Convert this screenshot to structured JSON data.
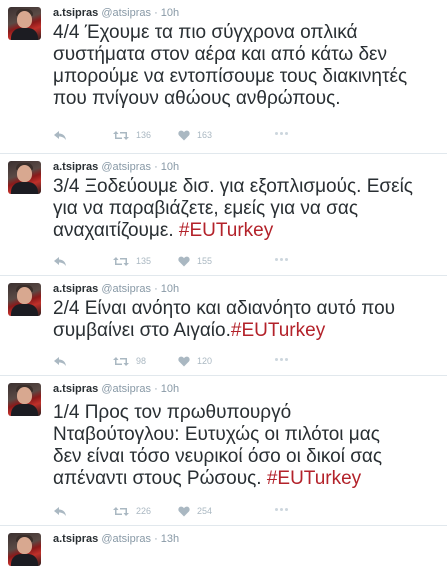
{
  "tweets": [
    {
      "name": "a.tsipras",
      "handle": "@atsipras",
      "sep": "·",
      "time": "10h",
      "lines": [
        "4/4 Έχουμε τα πιο σύγχρονα οπλικά",
        "συστήματα στον αέρα και από κάτω δεν",
        "μπορούμε να εντοπίσουμε τους διακινητές",
        "που πνίγουν αθώους ανθρώπους."
      ],
      "hashtag": "",
      "retweets": "136",
      "likes": "163"
    },
    {
      "name": "a.tsipras",
      "handle": "@atsipras",
      "sep": "·",
      "time": "10h",
      "lines": [
        "3/4 Ξοδεύουμε δισ. για εξοπλισμούς. Εσείς",
        "για να παραβιάζετε, εμείς για να σας",
        "αναχαιτίζουμε. "
      ],
      "hashtag": "#EUTurkey",
      "retweets": "135",
      "likes": "155"
    },
    {
      "name": "a.tsipras",
      "handle": "@atsipras",
      "sep": "·",
      "time": "10h",
      "lines": [
        "2/4 Είναι ανόητο και αδιανόητο αυτό που",
        "συμβαίνει στο Αιγαίο."
      ],
      "hashtag": "#EUTurkey",
      "retweets": "98",
      "likes": "120"
    },
    {
      "name": "a.tsipras",
      "handle": "@atsipras",
      "sep": "·",
      "time": "10h",
      "lines": [
        "1/4 Προς τον πρωθυπουργό",
        "Νταβούτογλου: Ευτυχώς οι πιλότοι μας",
        "δεν είναι τόσο νευρικοί όσο οι δικοί σας",
        "απέναντι στους Ρώσους. "
      ],
      "hashtag": "#EUTurkey",
      "retweets": "226",
      "likes": "254"
    },
    {
      "name": "a.tsipras",
      "handle": "@atsipras",
      "sep": "·",
      "time": "13h",
      "lines": [],
      "hashtag": "",
      "retweets": "",
      "likes": ""
    }
  ],
  "colors": {
    "hashtag": "#b3222a",
    "meta": "#8899a6",
    "icon": "#aab8c2",
    "divider": "#e1e8ed"
  },
  "icons": {
    "reply": "reply-icon",
    "retweet": "retweet-icon",
    "like": "heart-icon",
    "more": "more-icon"
  }
}
